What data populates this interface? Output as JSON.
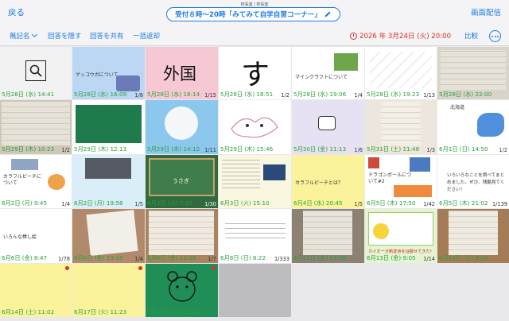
{
  "header": {
    "back_label": "戻る",
    "subtitle": "校長室 / 校長室",
    "title": "受付８時〜20時「みてみて自学自習コーナー」",
    "right_label": "画面配信"
  },
  "toolbar": {
    "anonymous_label": "無記名",
    "hide_answers_label": "回答を隠す",
    "share_answers_label": "回答を共有",
    "return_all_label": "一括返却",
    "deadline": "2026 年 3月24日 (火) 20:00",
    "compare_label": "比較"
  },
  "cells": [
    {
      "ts": "5月28日 (水) 14:41",
      "cnt": ""
    },
    {
      "ts": "5月28日 (水) 16:09",
      "cnt": "1/8",
      "text": "ゲッコウガについて"
    },
    {
      "ts": "5月28日 (水) 18:14",
      "cnt": "1/15",
      "text": "外国"
    },
    {
      "ts": "5月28日 (水) 18:51",
      "cnt": "1/2",
      "text": "す"
    },
    {
      "ts": "5月28日 (水) 19:06",
      "cnt": "1/4",
      "text": "マインクラフトについて"
    },
    {
      "ts": "5月28日 (水) 19:23",
      "cnt": "1/13"
    },
    {
      "ts": "5月28日 (水) 22:00",
      "cnt": ""
    },
    {
      "ts": "5月29日 (木) 10:23",
      "cnt": "1/2"
    },
    {
      "ts": "5月29日 (木) 12:13",
      "cnt": ""
    },
    {
      "ts": "5月29日 (木) 14:12",
      "cnt": "1/11"
    },
    {
      "ts": "5月29日 (木) 15:46",
      "cnt": ""
    },
    {
      "ts": "5月30日 (金) 11:13",
      "cnt": "1/6"
    },
    {
      "ts": "5月31日 (土) 11:48",
      "cnt": "1/3"
    },
    {
      "ts": "6月1日 (日) 14:50",
      "cnt": "1/2",
      "text": "北海道"
    },
    {
      "ts": "6月2日 (月) 9:45",
      "cnt": "1/4",
      "text": "カラフルピーチについて"
    },
    {
      "ts": "6月2日 (月) 19:58",
      "cnt": "1/5"
    },
    {
      "ts": "6月3日 (火) 7:35",
      "cnt": "1/30",
      "text": "うさぎ"
    },
    {
      "ts": "6月3日 (火) 15:10",
      "cnt": ""
    },
    {
      "ts": "6月4日 (水) 20:45",
      "cnt": "1/5",
      "text": "カラフルピーチとは？"
    },
    {
      "ts": "6月5日 (木) 17:50",
      "cnt": "1/42",
      "text": "ドラゴンボールについて#2"
    },
    {
      "ts": "6月5日 (木) 21:02",
      "cnt": "1/139",
      "text": "いろいろなことを調べてまとめました。ぜひ、残酷見てください！"
    },
    {
      "ts": "6月6日 (金) 8:47",
      "cnt": "1/78",
      "text": "いろんな棒し絵"
    },
    {
      "ts": "6月6日 (金) 13:15",
      "cnt": "1/4"
    },
    {
      "ts": "6月6日 (金) 13:16",
      "cnt": "1/7"
    },
    {
      "ts": "6月8日 (日) 8:22",
      "cnt": "1/333"
    },
    {
      "ts": "6月11日 (水) 17:08",
      "cnt": ""
    },
    {
      "ts": "6月13日 (金) 9:05",
      "cnt": "1/14",
      "text": "カイオーガ新変身を征服せてきた！"
    },
    {
      "ts": "6月14日 (土) 8:24",
      "cnt": ""
    },
    {
      "ts": "6月14日 (土) 11:02",
      "cnt": ""
    },
    {
      "ts": "6月17日 (火) 11:23",
      "cnt": ""
    },
    {
      "ts": "6月18日 (水) 13:24",
      "cnt": ""
    }
  ]
}
